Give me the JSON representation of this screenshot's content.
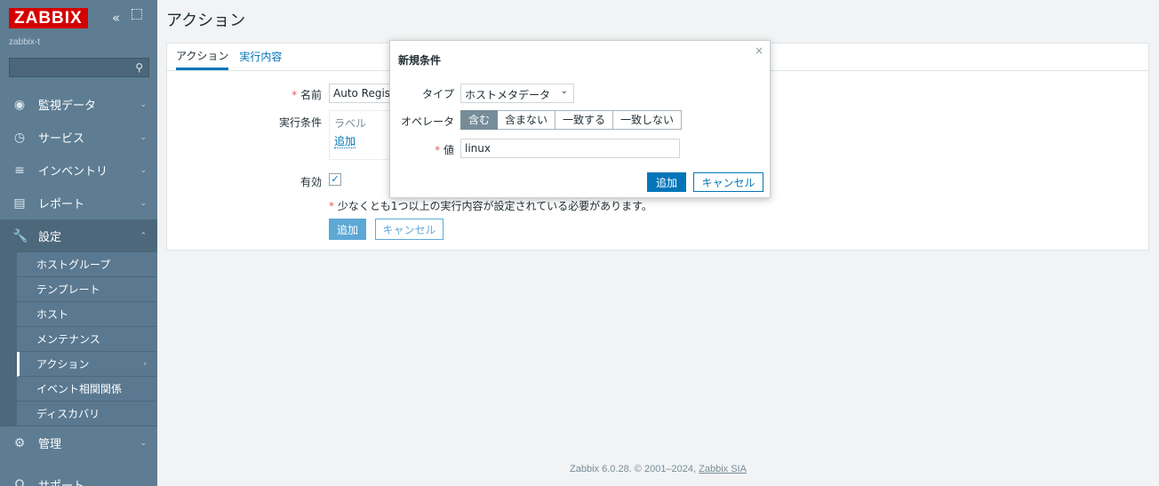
{
  "brand": {
    "logo": "ZABBIX",
    "server_name": "zabbix-t",
    "collapse_glyph": "«"
  },
  "sidebar": {
    "items": [
      {
        "label": "監視データ",
        "icon": "eye-icon",
        "glyph": "◉"
      },
      {
        "label": "サービス",
        "icon": "clock-icon",
        "glyph": "◷"
      },
      {
        "label": "インベントリ",
        "icon": "list-icon",
        "glyph": "≡"
      },
      {
        "label": "レポート",
        "icon": "report-icon",
        "glyph": "▤"
      },
      {
        "label": "設定",
        "icon": "wrench-icon",
        "glyph": "🔧"
      },
      {
        "label": "管理",
        "icon": "gear-icon",
        "glyph": "⚙"
      },
      {
        "label": "サポート",
        "icon": "support-icon",
        "glyph": "Ω"
      }
    ],
    "submenu": [
      "ホストグループ",
      "テンプレート",
      "ホスト",
      "メンテナンス",
      "アクション",
      "イベント相関関係",
      "ディスカバリ"
    ]
  },
  "page": {
    "title": "アクション"
  },
  "tabs": [
    "アクション",
    "実行内容"
  ],
  "form": {
    "name_label": "名前",
    "name_value": "Auto Registra",
    "conditions_label": "実行条件",
    "conditions_col_label": "ラベル",
    "conditions_add": "追加",
    "enabled_label": "有効",
    "warning": "少なくとも1つ以上の実行内容が設定されている必要があります。",
    "add_button": "追加",
    "cancel_button": "キャンセル",
    "required_mark": "*"
  },
  "dialog": {
    "title": "新規条件",
    "close": "×",
    "type_label": "タイプ",
    "type_value": "ホストメタデータ",
    "operator_label": "オペレータ",
    "operators": [
      "含む",
      "含まない",
      "一致する",
      "一致しない"
    ],
    "operator_selected": 0,
    "value_label": "値",
    "value": "linux",
    "add_button": "追加",
    "cancel_button": "キャンセル"
  },
  "footer": {
    "text": "Zabbix 6.0.28. © 2001–2024, ",
    "link": "Zabbix SIA"
  },
  "colors": {
    "sidebar": "#5e7d93",
    "accent": "#0275b8",
    "logo": "#d40000",
    "required": "#e45959"
  }
}
